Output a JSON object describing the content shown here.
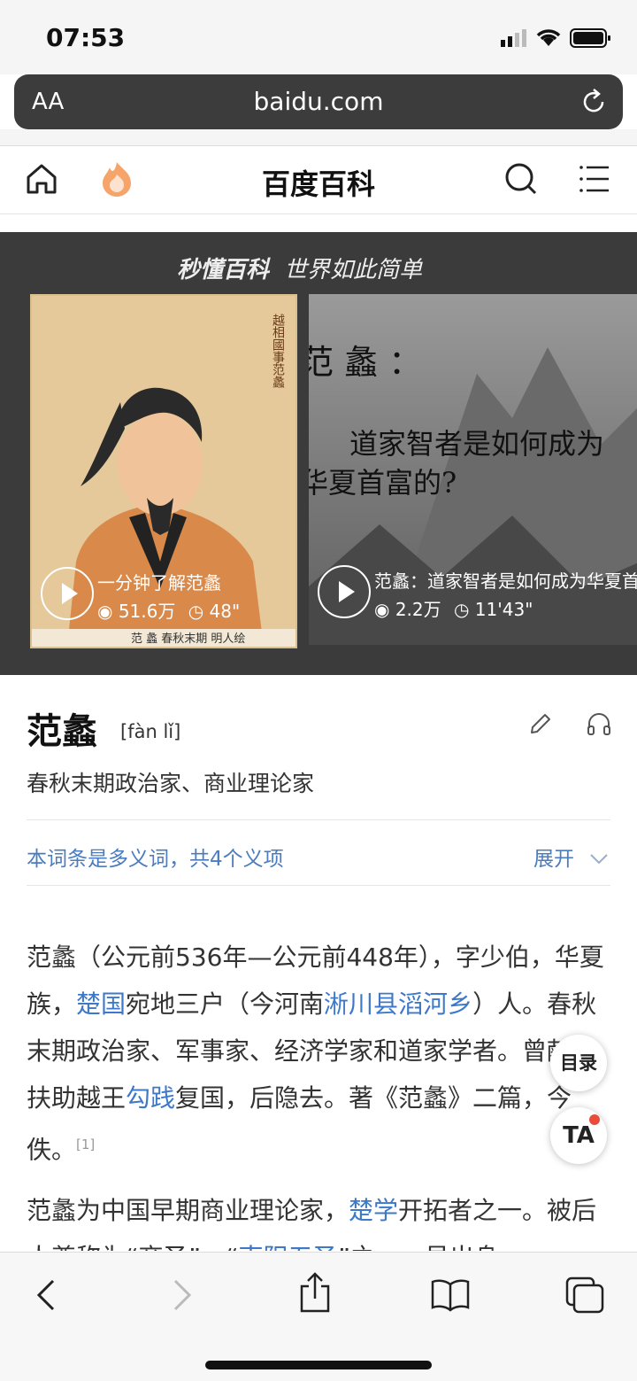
{
  "status": {
    "time": "07:53"
  },
  "browser": {
    "text_size_label": "AA",
    "url": "baidu.com"
  },
  "header": {
    "site_title": "百度百科"
  },
  "banner": {
    "brand": "秒懂百科",
    "slogan": "世界如此简单",
    "videos": [
      {
        "title": "一分钟了解范蠡",
        "views": "51.6万",
        "duration": "48\""
      },
      {
        "title": "范蠡：道家智者是如何成为华夏首富的?",
        "views": "2.2万",
        "duration": "11'43\""
      }
    ],
    "thumb2_text": {
      "line1": "范 蠡 ：",
      "line2": "道家智者是如何成为",
      "line3": "华夏首富的?"
    },
    "thumb1_caption": "范 蠡  春秋末期  明人绘",
    "thumb1_vertical": "越相國事范蠡"
  },
  "entry": {
    "title": "范蠡",
    "pinyin": "[fàn lǐ]",
    "subtitle": "春秋末期政治家、商业理论家",
    "polysemy": "本词条是多义词，共4个义项",
    "expand": "展开"
  },
  "paragraph1": {
    "t1": "范蠡（公元前536年—公元前448年），字少伯，华夏族，",
    "l1": "楚国",
    "t2": "宛地三户（今河南",
    "l2": "淅川县滔河乡",
    "t3": "）人。春秋末期政治家、军事家、经济学家和道家学者。曾献策扶助越王",
    "l3": "勾践",
    "t4": "复国，后隐去。著《范蠡》二篇，今佚。",
    "ref": "[1]"
  },
  "paragraph2": {
    "t1": "范蠡为中国早期商业理论家，",
    "l1": "楚学",
    "t2": "开拓者之一。被后人尊称为“商圣”，“",
    "l2": "南阳五圣",
    "t3": "”之一。虽出身"
  },
  "floating": {
    "toc": "目录",
    "ta": "TA"
  },
  "colors": {
    "link": "#3e78c8",
    "banner_bg": "#3b3b3b",
    "accent_flame": "#f5a56a"
  }
}
